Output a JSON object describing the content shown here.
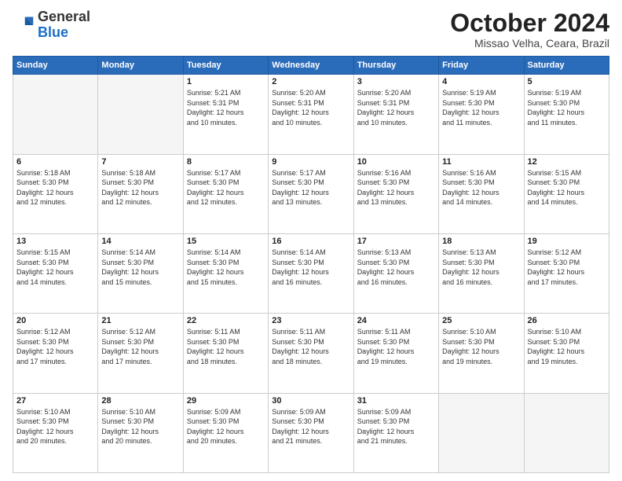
{
  "logo": {
    "general": "General",
    "blue": "Blue"
  },
  "header": {
    "month": "October 2024",
    "location": "Missao Velha, Ceara, Brazil"
  },
  "days_of_week": [
    "Sunday",
    "Monday",
    "Tuesday",
    "Wednesday",
    "Thursday",
    "Friday",
    "Saturday"
  ],
  "weeks": [
    [
      {
        "day": "",
        "info": ""
      },
      {
        "day": "",
        "info": ""
      },
      {
        "day": "1",
        "info": "Sunrise: 5:21 AM\nSunset: 5:31 PM\nDaylight: 12 hours\nand 10 minutes."
      },
      {
        "day": "2",
        "info": "Sunrise: 5:20 AM\nSunset: 5:31 PM\nDaylight: 12 hours\nand 10 minutes."
      },
      {
        "day": "3",
        "info": "Sunrise: 5:20 AM\nSunset: 5:31 PM\nDaylight: 12 hours\nand 10 minutes."
      },
      {
        "day": "4",
        "info": "Sunrise: 5:19 AM\nSunset: 5:30 PM\nDaylight: 12 hours\nand 11 minutes."
      },
      {
        "day": "5",
        "info": "Sunrise: 5:19 AM\nSunset: 5:30 PM\nDaylight: 12 hours\nand 11 minutes."
      }
    ],
    [
      {
        "day": "6",
        "info": "Sunrise: 5:18 AM\nSunset: 5:30 PM\nDaylight: 12 hours\nand 12 minutes."
      },
      {
        "day": "7",
        "info": "Sunrise: 5:18 AM\nSunset: 5:30 PM\nDaylight: 12 hours\nand 12 minutes."
      },
      {
        "day": "8",
        "info": "Sunrise: 5:17 AM\nSunset: 5:30 PM\nDaylight: 12 hours\nand 12 minutes."
      },
      {
        "day": "9",
        "info": "Sunrise: 5:17 AM\nSunset: 5:30 PM\nDaylight: 12 hours\nand 13 minutes."
      },
      {
        "day": "10",
        "info": "Sunrise: 5:16 AM\nSunset: 5:30 PM\nDaylight: 12 hours\nand 13 minutes."
      },
      {
        "day": "11",
        "info": "Sunrise: 5:16 AM\nSunset: 5:30 PM\nDaylight: 12 hours\nand 14 minutes."
      },
      {
        "day": "12",
        "info": "Sunrise: 5:15 AM\nSunset: 5:30 PM\nDaylight: 12 hours\nand 14 minutes."
      }
    ],
    [
      {
        "day": "13",
        "info": "Sunrise: 5:15 AM\nSunset: 5:30 PM\nDaylight: 12 hours\nand 14 minutes."
      },
      {
        "day": "14",
        "info": "Sunrise: 5:14 AM\nSunset: 5:30 PM\nDaylight: 12 hours\nand 15 minutes."
      },
      {
        "day": "15",
        "info": "Sunrise: 5:14 AM\nSunset: 5:30 PM\nDaylight: 12 hours\nand 15 minutes."
      },
      {
        "day": "16",
        "info": "Sunrise: 5:14 AM\nSunset: 5:30 PM\nDaylight: 12 hours\nand 16 minutes."
      },
      {
        "day": "17",
        "info": "Sunrise: 5:13 AM\nSunset: 5:30 PM\nDaylight: 12 hours\nand 16 minutes."
      },
      {
        "day": "18",
        "info": "Sunrise: 5:13 AM\nSunset: 5:30 PM\nDaylight: 12 hours\nand 16 minutes."
      },
      {
        "day": "19",
        "info": "Sunrise: 5:12 AM\nSunset: 5:30 PM\nDaylight: 12 hours\nand 17 minutes."
      }
    ],
    [
      {
        "day": "20",
        "info": "Sunrise: 5:12 AM\nSunset: 5:30 PM\nDaylight: 12 hours\nand 17 minutes."
      },
      {
        "day": "21",
        "info": "Sunrise: 5:12 AM\nSunset: 5:30 PM\nDaylight: 12 hours\nand 17 minutes."
      },
      {
        "day": "22",
        "info": "Sunrise: 5:11 AM\nSunset: 5:30 PM\nDaylight: 12 hours\nand 18 minutes."
      },
      {
        "day": "23",
        "info": "Sunrise: 5:11 AM\nSunset: 5:30 PM\nDaylight: 12 hours\nand 18 minutes."
      },
      {
        "day": "24",
        "info": "Sunrise: 5:11 AM\nSunset: 5:30 PM\nDaylight: 12 hours\nand 19 minutes."
      },
      {
        "day": "25",
        "info": "Sunrise: 5:10 AM\nSunset: 5:30 PM\nDaylight: 12 hours\nand 19 minutes."
      },
      {
        "day": "26",
        "info": "Sunrise: 5:10 AM\nSunset: 5:30 PM\nDaylight: 12 hours\nand 19 minutes."
      }
    ],
    [
      {
        "day": "27",
        "info": "Sunrise: 5:10 AM\nSunset: 5:30 PM\nDaylight: 12 hours\nand 20 minutes."
      },
      {
        "day": "28",
        "info": "Sunrise: 5:10 AM\nSunset: 5:30 PM\nDaylight: 12 hours\nand 20 minutes."
      },
      {
        "day": "29",
        "info": "Sunrise: 5:09 AM\nSunset: 5:30 PM\nDaylight: 12 hours\nand 20 minutes."
      },
      {
        "day": "30",
        "info": "Sunrise: 5:09 AM\nSunset: 5:30 PM\nDaylight: 12 hours\nand 21 minutes."
      },
      {
        "day": "31",
        "info": "Sunrise: 5:09 AM\nSunset: 5:30 PM\nDaylight: 12 hours\nand 21 minutes."
      },
      {
        "day": "",
        "info": ""
      },
      {
        "day": "",
        "info": ""
      }
    ]
  ]
}
